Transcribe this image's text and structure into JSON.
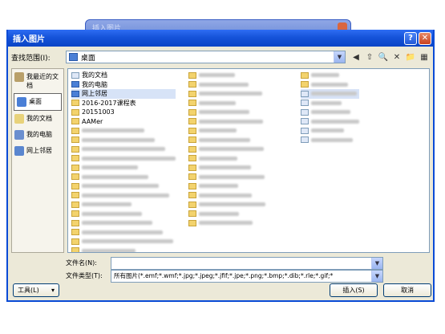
{
  "background_window": {
    "title": "插入图片"
  },
  "dialog": {
    "title": "插入图片",
    "help_symbol": "?",
    "close_symbol": "✕"
  },
  "toolbar": {
    "look_in_label": "查找范围(I):",
    "look_in_value": "桌面",
    "back_symbol": "◀",
    "up_symbol": "⇧",
    "search_symbol": "🔍",
    "delete_symbol": "✕",
    "new_folder_symbol": "📁",
    "views_symbol": "▦"
  },
  "places": [
    {
      "label": "我最近的文档",
      "icon": "recent-docs-icon",
      "color": "#b9a06a"
    },
    {
      "label": "桌面",
      "icon": "desktop-icon",
      "color": "#4a7fd6",
      "selected": true
    },
    {
      "label": "我的文档",
      "icon": "my-documents-icon",
      "color": "#e8d27a"
    },
    {
      "label": "我的电脑",
      "icon": "my-computer-icon",
      "color": "#6b8fcf"
    },
    {
      "label": "网上邻居",
      "icon": "network-places-icon",
      "color": "#5a86cf"
    }
  ],
  "files": {
    "col1": [
      {
        "name": "我的文档",
        "type": "doc"
      },
      {
        "name": "我的电脑",
        "type": "blue"
      },
      {
        "name": "网上邻居",
        "type": "blue",
        "highlight": true
      },
      {
        "name": "2016-2017课程表",
        "type": "folder"
      },
      {
        "name": "20151003",
        "type": "folder"
      },
      {
        "name": "AAMer",
        "type": "folder"
      },
      {
        "name": "",
        "type": "folder"
      },
      {
        "name": "",
        "type": "folder"
      },
      {
        "name": "",
        "type": "folder"
      },
      {
        "name": "",
        "type": "folder"
      },
      {
        "name": "",
        "type": "folder"
      },
      {
        "name": "",
        "type": "folder"
      },
      {
        "name": "",
        "type": "folder"
      },
      {
        "name": "",
        "type": "folder"
      },
      {
        "name": "",
        "type": "folder"
      },
      {
        "name": "",
        "type": "folder"
      },
      {
        "name": "",
        "type": "folder"
      },
      {
        "name": "",
        "type": "folder"
      },
      {
        "name": "",
        "type": "folder"
      },
      {
        "name": "",
        "type": "folder"
      }
    ],
    "col2_count": 17,
    "col3_count": 8
  },
  "footer": {
    "file_name_label": "文件名(N):",
    "file_name_value": "",
    "file_type_label": "文件类型(T):",
    "file_type_value": "所有图片(*.emf;*.wmf;*.jpg;*.jpeg;*.jfif;*.jpe;*.png;*.bmp;*.dib;*.rle;*.gif;*",
    "tools_label": "工具(L)",
    "insert_label": "插入(S)",
    "cancel_label": "取消"
  }
}
